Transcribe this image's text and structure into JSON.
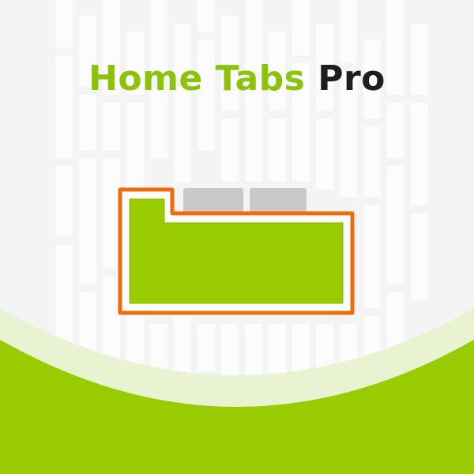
{
  "title": {
    "main": "Home Tabs",
    "suffix": "Pro"
  },
  "colors": {
    "brand_green": "#8cc20b",
    "tab_fill_green": "#99cc00",
    "outline_orange": "#ee6c0e",
    "inactive_tab_gray": "#c8c8c8",
    "title_dark": "#1e1e1e",
    "background": "#f4f4f4",
    "wave_light": "#e8f3d2"
  },
  "icon": {
    "name": "tabs-folder-icon",
    "inactive_tabs": 2
  }
}
